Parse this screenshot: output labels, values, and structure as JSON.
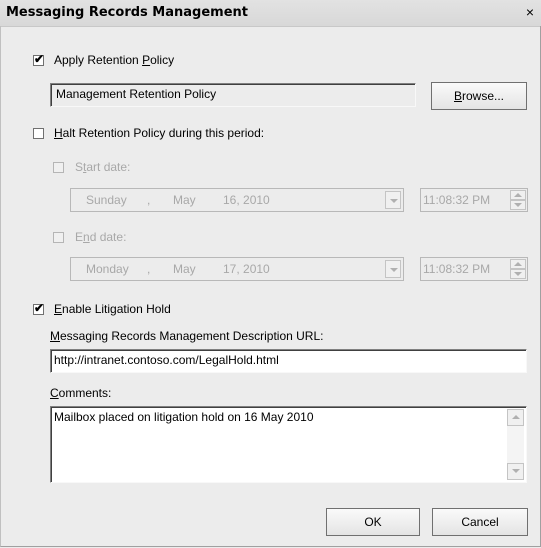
{
  "window": {
    "title": "Messaging Records Management",
    "close_glyph": "×"
  },
  "apply_retention": {
    "checked": true,
    "label_pre": "Apply Retention ",
    "label_accel": "P",
    "label_post": "olicy"
  },
  "retention_policy_value": "Management Retention Policy",
  "browse_button": {
    "accel": "B",
    "rest": "rowse..."
  },
  "halt_retention": {
    "checked": false,
    "label_accel": "H",
    "label_post": "alt Retention Policy during this period:"
  },
  "start_date": {
    "checked": false,
    "label_pre": "S",
    "label_accel": "t",
    "label_post": "art date:",
    "weekday": "Sunday",
    "sep": ",",
    "month": "May",
    "day_year": "16, 2010",
    "time": "11:08:32 PM"
  },
  "end_date": {
    "checked": false,
    "label_pre": "E",
    "label_accel": "n",
    "label_post": "d date:",
    "weekday": "Monday",
    "sep": ",",
    "month": "May",
    "day_year": "17, 2010",
    "time": "11:08:32 PM"
  },
  "litigation_hold": {
    "checked": true,
    "label_accel": "E",
    "label_post": "nable Litigation Hold"
  },
  "description_url": {
    "label_accel": "M",
    "label_post": "essaging Records Management Description URL:",
    "value": "http://intranet.contoso.com/LegalHold.html"
  },
  "comments": {
    "label_accel": "C",
    "label_post": "omments:",
    "value": "Mailbox placed on litigation hold on 16 May 2010"
  },
  "ok_button": "OK",
  "cancel_button": "Cancel"
}
